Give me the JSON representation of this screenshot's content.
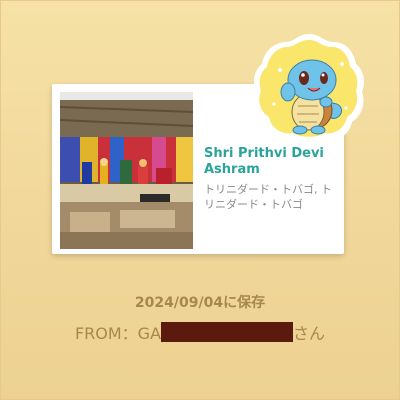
{
  "colors": {
    "background": "#f3dc9f",
    "name_teal": "#2aa39a",
    "footer_text": "#a7884c",
    "redaction": "#5a1a0e",
    "sticker_yellow": "#f9e66a",
    "squirtle_blue": "#6fc3e8"
  },
  "card": {
    "name": "Shri Prithvi Devi Ashram",
    "address": "トリニダード・トバゴ, トリニダード・トバゴ"
  },
  "sticker": {
    "icon": "squirtle-postcard-sticker"
  },
  "footer": {
    "saved_text": "2024/09/04に保存",
    "from_prefix": "FROM：GA",
    "from_suffix": "さん"
  }
}
